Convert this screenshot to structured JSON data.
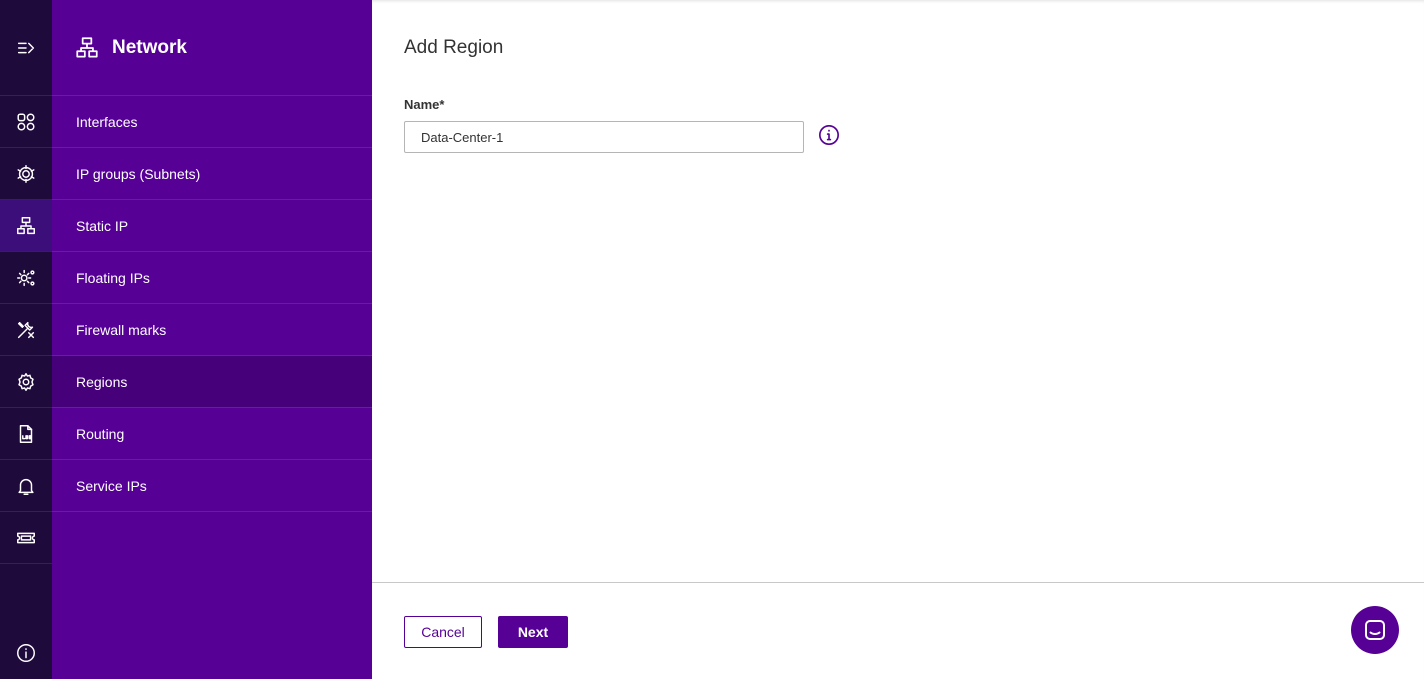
{
  "sidebar": {
    "title": "Network",
    "items": [
      {
        "label": "Interfaces"
      },
      {
        "label": "IP groups (Subnets)"
      },
      {
        "label": "Static IP"
      },
      {
        "label": "Floating IPs"
      },
      {
        "label": "Firewall marks"
      },
      {
        "label": "Regions",
        "active": true
      },
      {
        "label": "Routing"
      },
      {
        "label": "Service IPs"
      }
    ]
  },
  "rail": {
    "icons": [
      "expand-menu-icon",
      "dashboard-icon",
      "cluster-settings-icon",
      "network-icon",
      "services-icon",
      "tools-icon",
      "settings-icon",
      "log-file-icon",
      "notifications-bell-icon",
      "license-ticket-icon",
      "info-icon"
    ]
  },
  "main": {
    "title": "Add Region",
    "form": {
      "name_label": "Name*",
      "name_value": "Data-Center-1"
    },
    "buttons": {
      "cancel": "Cancel",
      "next": "Next"
    }
  },
  "colors": {
    "rail_bg": "#1f0a3c",
    "subnav_bg": "#560095",
    "subnav_active": "#45007a",
    "accent": "#560095"
  }
}
